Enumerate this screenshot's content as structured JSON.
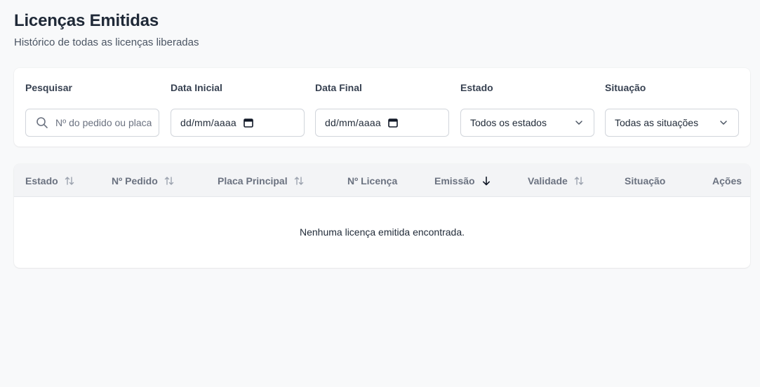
{
  "header": {
    "title": "Licenças Emitidas",
    "subtitle": "Histórico de todas as licenças liberadas"
  },
  "filters": {
    "search": {
      "label": "Pesquisar",
      "placeholder": "Nº do pedido ou placa",
      "icon": "search-icon"
    },
    "start_date": {
      "label": "Data Inicial",
      "value": "dd/mm/aaaa",
      "icon": "calendar-icon"
    },
    "end_date": {
      "label": "Data Final",
      "value": "dd/mm/aaaa",
      "icon": "calendar-icon"
    },
    "state": {
      "label": "Estado",
      "selected": "Todos os estados"
    },
    "status": {
      "label": "Situação",
      "selected": "Todas as situações"
    }
  },
  "table": {
    "columns": [
      {
        "label": "Estado",
        "sort": "both"
      },
      {
        "label": "Nº Pedido",
        "sort": "both"
      },
      {
        "label": "Placa Principal",
        "sort": "both"
      },
      {
        "label": "Nº Licença",
        "sort": "none"
      },
      {
        "label": "Emissão",
        "sort": "desc"
      },
      {
        "label": "Validade",
        "sort": "both"
      },
      {
        "label": "Situação",
        "sort": "none"
      },
      {
        "label": "Ações",
        "sort": "none"
      }
    ],
    "empty_message": "Nenhuma licença emitida encontrada."
  },
  "colors": {
    "background": "#f8f9fa",
    "card": "#ffffff",
    "table_header": "#f3f4f6",
    "title": "#1f2937",
    "muted": "#6b7280"
  }
}
